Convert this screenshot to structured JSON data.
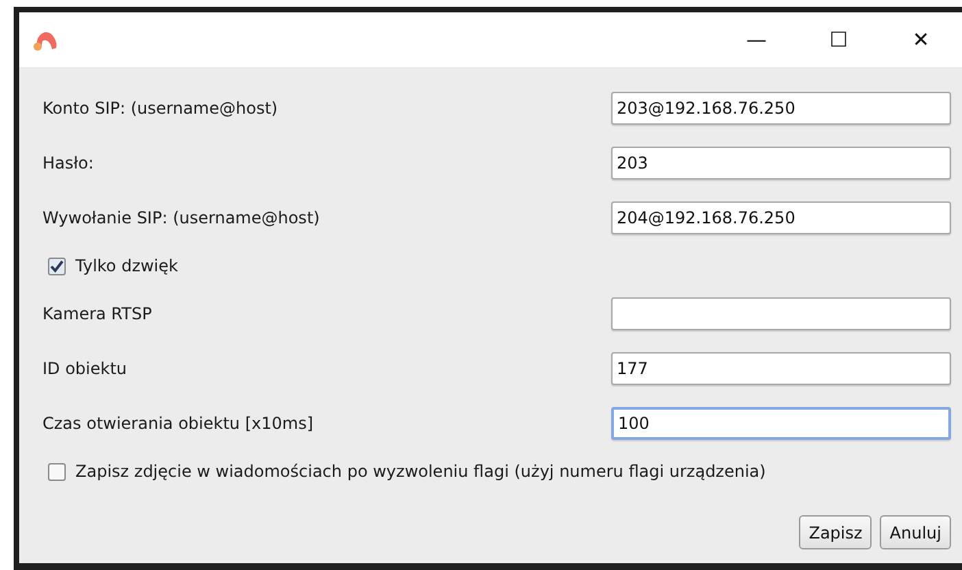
{
  "window": {
    "title_buttons": [
      "—",
      "☐",
      "✕"
    ]
  },
  "rows": [
    {
      "kind": "field",
      "label": "Konto SIP: (username@host)",
      "value": "203@192.168.76.250",
      "focused": false
    },
    {
      "kind": "field",
      "label": "Hasło:",
      "value": "203",
      "focused": false
    },
    {
      "kind": "field",
      "label": "Wywołanie SIP: (username@host)",
      "value": "204@192.168.76.250",
      "focused": false
    },
    {
      "kind": "checkbox",
      "label": "Tylko dzwięk",
      "checked": true
    },
    {
      "kind": "field",
      "label": "Kamera RTSP",
      "focused": false
    },
    {
      "kind": "field",
      "label": "ID obiektu",
      "value": "177",
      "focused": false
    },
    {
      "kind": "field",
      "label": "Czas otwierania obiektu [x10ms]",
      "value": "100",
      "focused": true
    },
    {
      "kind": "checkbox",
      "label": "Zapisz zdjęcie w wiadomościach po wyzwoleniu flagi (użyj numeru flagi urządzenia)",
      "checked": false
    }
  ],
  "buttons": [
    "Zapisz",
    "Anuluj"
  ]
}
